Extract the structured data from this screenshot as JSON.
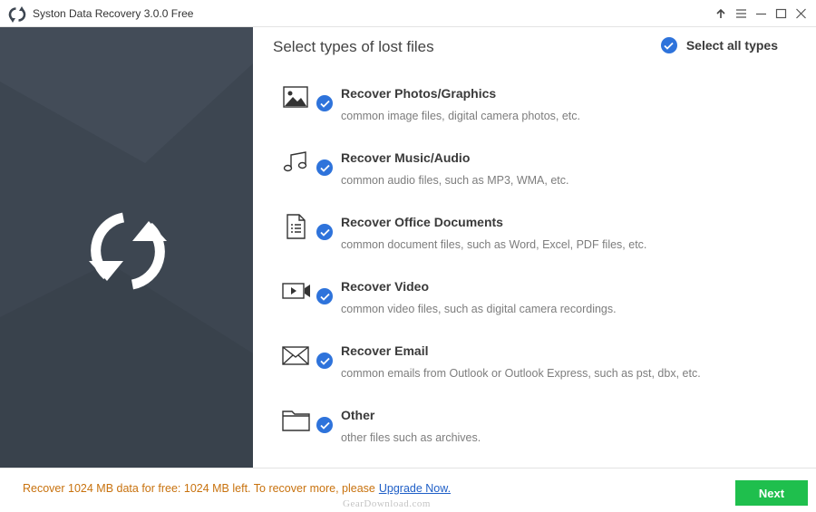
{
  "window": {
    "title": "Syston Data Recovery 3.0.0 Free",
    "controls": [
      "upload-icon",
      "menu-icon",
      "minimize-icon",
      "maximize-icon",
      "close-icon"
    ]
  },
  "colors": {
    "sidebar_bg": "#3d4651",
    "accent_check": "#2e73db",
    "next_button": "#1fbf4d",
    "footer_text": "#c8720e",
    "link": "#1f5fc7"
  },
  "main": {
    "title": "Select types of lost files",
    "select_all_label": "Select all types",
    "select_all_checked": true,
    "types": [
      {
        "icon": "photo-icon",
        "title": "Recover Photos/Graphics",
        "desc": "common image files, digital camera photos, etc.",
        "checked": true
      },
      {
        "icon": "music-icon",
        "title": "Recover Music/Audio",
        "desc": "common audio files, such as MP3, WMA, etc.",
        "checked": true
      },
      {
        "icon": "document-icon",
        "title": "Recover Office Documents",
        "desc": "common document files, such as Word, Excel, PDF files, etc.",
        "checked": true
      },
      {
        "icon": "video-icon",
        "title": "Recover Video",
        "desc": "common video files, such as digital camera recordings.",
        "checked": true
      },
      {
        "icon": "email-icon",
        "title": "Recover Email",
        "desc": "common emails from Outlook or Outlook Express, such as pst, dbx, etc.",
        "checked": true
      },
      {
        "icon": "folder-icon",
        "title": "Other",
        "desc": "other files such as archives.",
        "checked": true
      }
    ]
  },
  "footer": {
    "message": "Recover 1024 MB data for free: 1024 MB left. To recover more, please",
    "upgrade_link": "Upgrade Now.",
    "next_label": "Next",
    "watermark": "GearDownload.com"
  }
}
